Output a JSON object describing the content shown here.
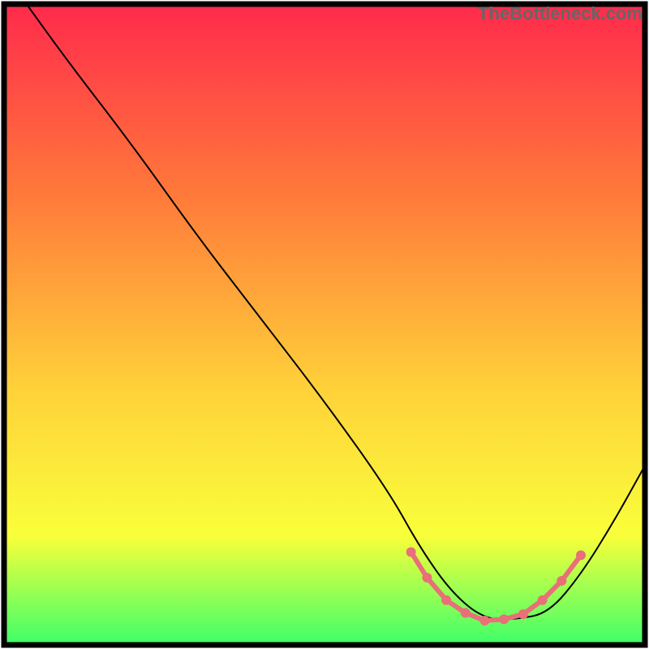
{
  "watermark": "TheBottleneck.com",
  "chart_data": {
    "type": "line",
    "title": "",
    "xlabel": "",
    "ylabel": "",
    "xlim": [
      0.0,
      1.0
    ],
    "ylim": [
      0.0,
      1.0
    ],
    "gradient_colors_top_to_bottom": [
      "#ff2a4c",
      "#ff7a3a",
      "#ffd13a",
      "#f9ff3a",
      "#3dff6a"
    ],
    "series": [
      {
        "name": "curve",
        "type": "line",
        "color": "#000000",
        "x": [
          0.035,
          0.1,
          0.2,
          0.3,
          0.4,
          0.5,
          0.6,
          0.65,
          0.7,
          0.75,
          0.8,
          0.85,
          0.9,
          0.95,
          1.0
        ],
        "y": [
          1.0,
          0.91,
          0.78,
          0.64,
          0.51,
          0.38,
          0.24,
          0.15,
          0.08,
          0.04,
          0.04,
          0.05,
          0.11,
          0.19,
          0.28
        ]
      },
      {
        "name": "highlight",
        "type": "line-with-dots",
        "color": "#e96f78",
        "x": [
          0.635,
          0.66,
          0.69,
          0.72,
          0.75,
          0.78,
          0.81,
          0.84,
          0.87,
          0.9
        ],
        "y": [
          0.145,
          0.105,
          0.07,
          0.05,
          0.038,
          0.04,
          0.048,
          0.07,
          0.1,
          0.14
        ]
      }
    ]
  }
}
